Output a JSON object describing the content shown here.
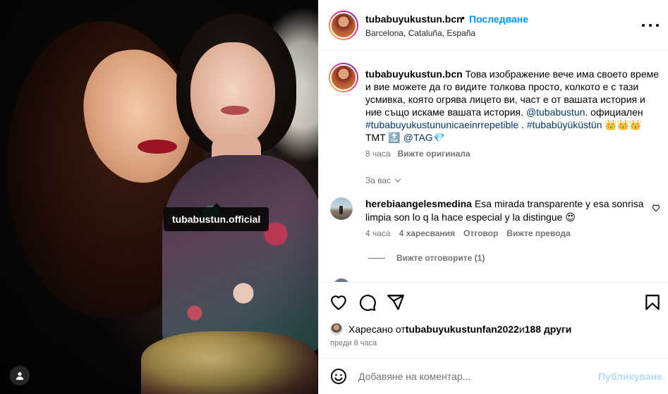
{
  "media": {
    "tag_label": "tubabustun.official"
  },
  "header": {
    "username": "tubabuyukustun.bcn",
    "dot": "•",
    "follow_label": "Последване",
    "location": "Barcelona, Cataluña, España"
  },
  "caption": {
    "username": "tubabuyukustun.bcn",
    "text_part1": " Това изображение вече има своето време и вие можете да го видите толкова просто, колкото е с тази усмивка, която огрява лицето ви, част е от вашата история и ние също искаме вашата история. ",
    "mention1": "@tubabustun",
    "text_part2": ". официален ",
    "hashtag1": "#tubabuyukustununicaeinrrepetible",
    "text_part3": " . ",
    "hashtag2": "#tubabüyüküstün",
    "text_part4": " 👑👑👑 TMT 🔝 ",
    "mention2": "@TAG",
    "text_part5": "💎",
    "time": "8 часа",
    "see_original": "Вижте оригинала"
  },
  "sort": {
    "label": "За вас"
  },
  "comment": {
    "username": "herebiaangelesmedina",
    "text": " Esa mirada transparente y esa sonrisa limpia son lo q la hace especial y la distingue 😍",
    "time": "4 часа",
    "likes": "4 харесвания",
    "reply": "Отговор",
    "see_translation": "Вижте превода",
    "view_replies": "Вижте отговорите (1)"
  },
  "likes": {
    "prefix": "Харесано от ",
    "user": "tubabuyukustunfan2022",
    "middle": " и ",
    "others": "188 други",
    "posted": "преди 8 часа"
  },
  "composer": {
    "placeholder": "Добавяне на коментар...",
    "post_label": "Публикуване"
  },
  "colors": {
    "link_blue": "#0095f6",
    "mention_blue": "#00376b",
    "muted": "#737373",
    "post_disabled": "#b3dbff"
  },
  "icons": [
    "user-tag-icon",
    "more-options-icon",
    "heart-icon",
    "comment-icon",
    "share-icon",
    "bookmark-icon",
    "emoji-icon",
    "chevron-down-icon"
  ]
}
